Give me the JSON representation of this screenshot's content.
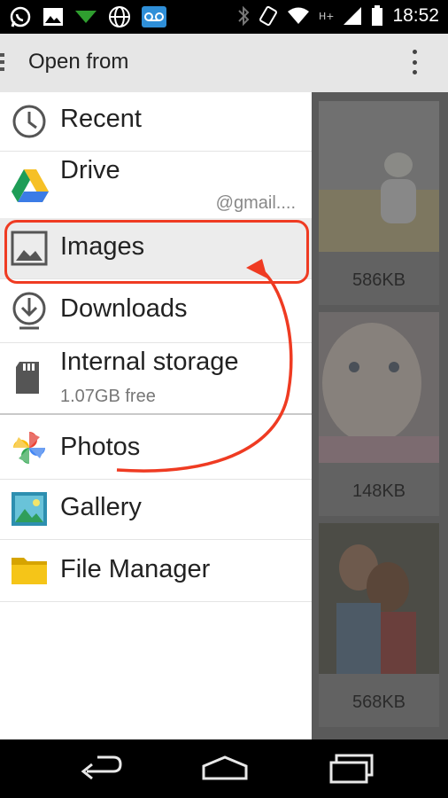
{
  "status_bar": {
    "time": "18:52",
    "network": "H+",
    "left_icons": [
      "whatsapp-icon",
      "image-icon",
      "download-arrow-icon",
      "globe-icon",
      "voicemail-icon"
    ],
    "right_icons": [
      "bluetooth-icon",
      "screen-rotate-icon",
      "wifi-icon",
      "signal-icon",
      "battery-icon"
    ]
  },
  "app_bar": {
    "title": "Open from"
  },
  "drawer": {
    "items": [
      {
        "label": "Recent",
        "icon": "clock-icon"
      },
      {
        "label": "Drive",
        "account": "@gmail....",
        "icon": "google-drive-icon"
      },
      {
        "label": "Images",
        "icon": "image-icon",
        "highlighted": true
      },
      {
        "label": "Downloads",
        "icon": "download-icon"
      },
      {
        "label": "Internal storage",
        "sub": "1.07GB free",
        "icon": "sd-card-icon"
      },
      {
        "label": "Photos",
        "icon": "google-photos-icon"
      },
      {
        "label": "Gallery",
        "icon": "gallery-icon"
      },
      {
        "label": "File Manager",
        "icon": "folder-icon"
      }
    ]
  },
  "background_files": [
    {
      "size": "586KB"
    },
    {
      "size": "148KB"
    },
    {
      "size": "568KB"
    }
  ],
  "annotation": {
    "color": "#ef3b22"
  },
  "nav_bar": {
    "buttons": [
      "back-icon",
      "home-icon",
      "recents-icon"
    ]
  }
}
